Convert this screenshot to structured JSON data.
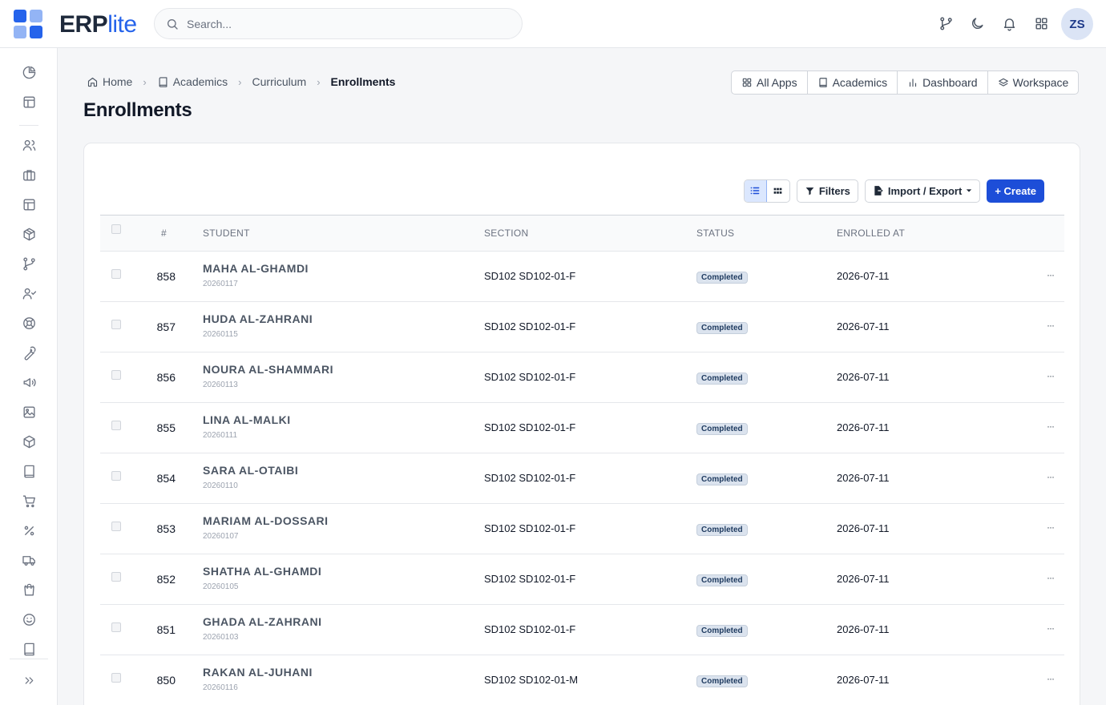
{
  "app": {
    "brand_main": "ERP",
    "brand_accent": "lite",
    "accent_color": "#2563eb"
  },
  "search": {
    "placeholder": "Search..."
  },
  "user": {
    "initials": "ZS"
  },
  "topbar_icons": [
    "git-branch-icon",
    "moon-icon",
    "bell-icon",
    "apps-grid-icon"
  ],
  "sidebar": {
    "icons": [
      "pie-chart-icon",
      "layout-icon",
      "users-icon",
      "briefcase-icon",
      "table-icon",
      "box-icon",
      "git-branch-icon",
      "user-check-icon",
      "lifebuoy-icon",
      "wrench-icon",
      "megaphone-icon",
      "image-icon",
      "package-icon",
      "book-icon",
      "cart-icon",
      "percent-icon",
      "truck-icon",
      "shopping-bag-icon",
      "smile-icon",
      "book-open-icon",
      "expand-icon"
    ]
  },
  "breadcrumb": {
    "items": [
      "Home",
      "Academics",
      "Curriculum"
    ],
    "current": "Enrollments"
  },
  "page": {
    "title": "Enrollments"
  },
  "app_nav": {
    "all_apps": "All Apps",
    "academics": "Academics",
    "dashboard": "Dashboard",
    "workspace": "Workspace"
  },
  "toolbar": {
    "filters": "Filters",
    "import_export": "Import / Export",
    "create": "+ Create"
  },
  "table": {
    "columns": {
      "num": "#",
      "student": "STUDENT",
      "section": "SECTION",
      "status": "STATUS",
      "enrolled_at": "ENROLLED AT"
    },
    "more_label": "···",
    "rows": [
      {
        "num": "858",
        "name": "MAHA AL-GHAMDI",
        "code": "20260117",
        "section": "SD102 SD102-01-F",
        "status": "Completed",
        "date": "2026-07-11"
      },
      {
        "num": "857",
        "name": "HUDA AL-ZAHRANI",
        "code": "20260115",
        "section": "SD102 SD102-01-F",
        "status": "Completed",
        "date": "2026-07-11"
      },
      {
        "num": "856",
        "name": "NOURA AL-SHAMMARI",
        "code": "20260113",
        "section": "SD102 SD102-01-F",
        "status": "Completed",
        "date": "2026-07-11"
      },
      {
        "num": "855",
        "name": "LINA AL-MALKI",
        "code": "20260111",
        "section": "SD102 SD102-01-F",
        "status": "Completed",
        "date": "2026-07-11"
      },
      {
        "num": "854",
        "name": "SARA AL-OTAIBI",
        "code": "20260110",
        "section": "SD102 SD102-01-F",
        "status": "Completed",
        "date": "2026-07-11"
      },
      {
        "num": "853",
        "name": "MARIAM AL-DOSSARI",
        "code": "20260107",
        "section": "SD102 SD102-01-F",
        "status": "Completed",
        "date": "2026-07-11"
      },
      {
        "num": "852",
        "name": "SHATHA AL-GHAMDI",
        "code": "20260105",
        "section": "SD102 SD102-01-F",
        "status": "Completed",
        "date": "2026-07-11"
      },
      {
        "num": "851",
        "name": "GHADA AL-ZAHRANI",
        "code": "20260103",
        "section": "SD102 SD102-01-F",
        "status": "Completed",
        "date": "2026-07-11"
      },
      {
        "num": "850",
        "name": "RAKAN AL-JUHANI",
        "code": "20260116",
        "section": "SD102 SD102-01-M",
        "status": "Completed",
        "date": "2026-07-11"
      }
    ]
  }
}
